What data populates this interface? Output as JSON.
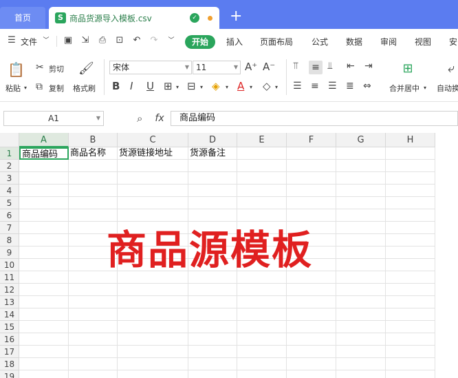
{
  "tabs": {
    "home": "首页",
    "file_title": "商品货源导入模板.csv",
    "add": "+"
  },
  "menu": {
    "file": "文件",
    "start": "开始",
    "items": [
      "插入",
      "页面布局",
      "公式",
      "数据",
      "审阅",
      "视图",
      "安"
    ]
  },
  "ribbon": {
    "paste": "粘贴",
    "cut": "剪切",
    "copy": "复制",
    "format_painter": "格式刷",
    "font_name": "宋体",
    "font_size": "11",
    "merge_center": "合并居中",
    "auto_wrap": "自动换"
  },
  "formula_bar": {
    "cell_ref": "A1",
    "fx": "fx",
    "value": "商品编码"
  },
  "columns": [
    "A",
    "B",
    "C",
    "D",
    "E",
    "F",
    "G",
    "H"
  ],
  "rows": [
    "1",
    "2",
    "3",
    "4",
    "5",
    "6",
    "7",
    "8",
    "9",
    "10",
    "11",
    "12",
    "13",
    "14",
    "15",
    "16",
    "17",
    "18",
    "19"
  ],
  "row1": [
    "商品编码",
    "商品名称",
    "货源链接地址",
    "货源备注"
  ],
  "watermark": "商品源模板",
  "colors": {
    "accent": "#2aa55c",
    "tabbar": "#5b7cf0",
    "watermark": "#e02020"
  }
}
